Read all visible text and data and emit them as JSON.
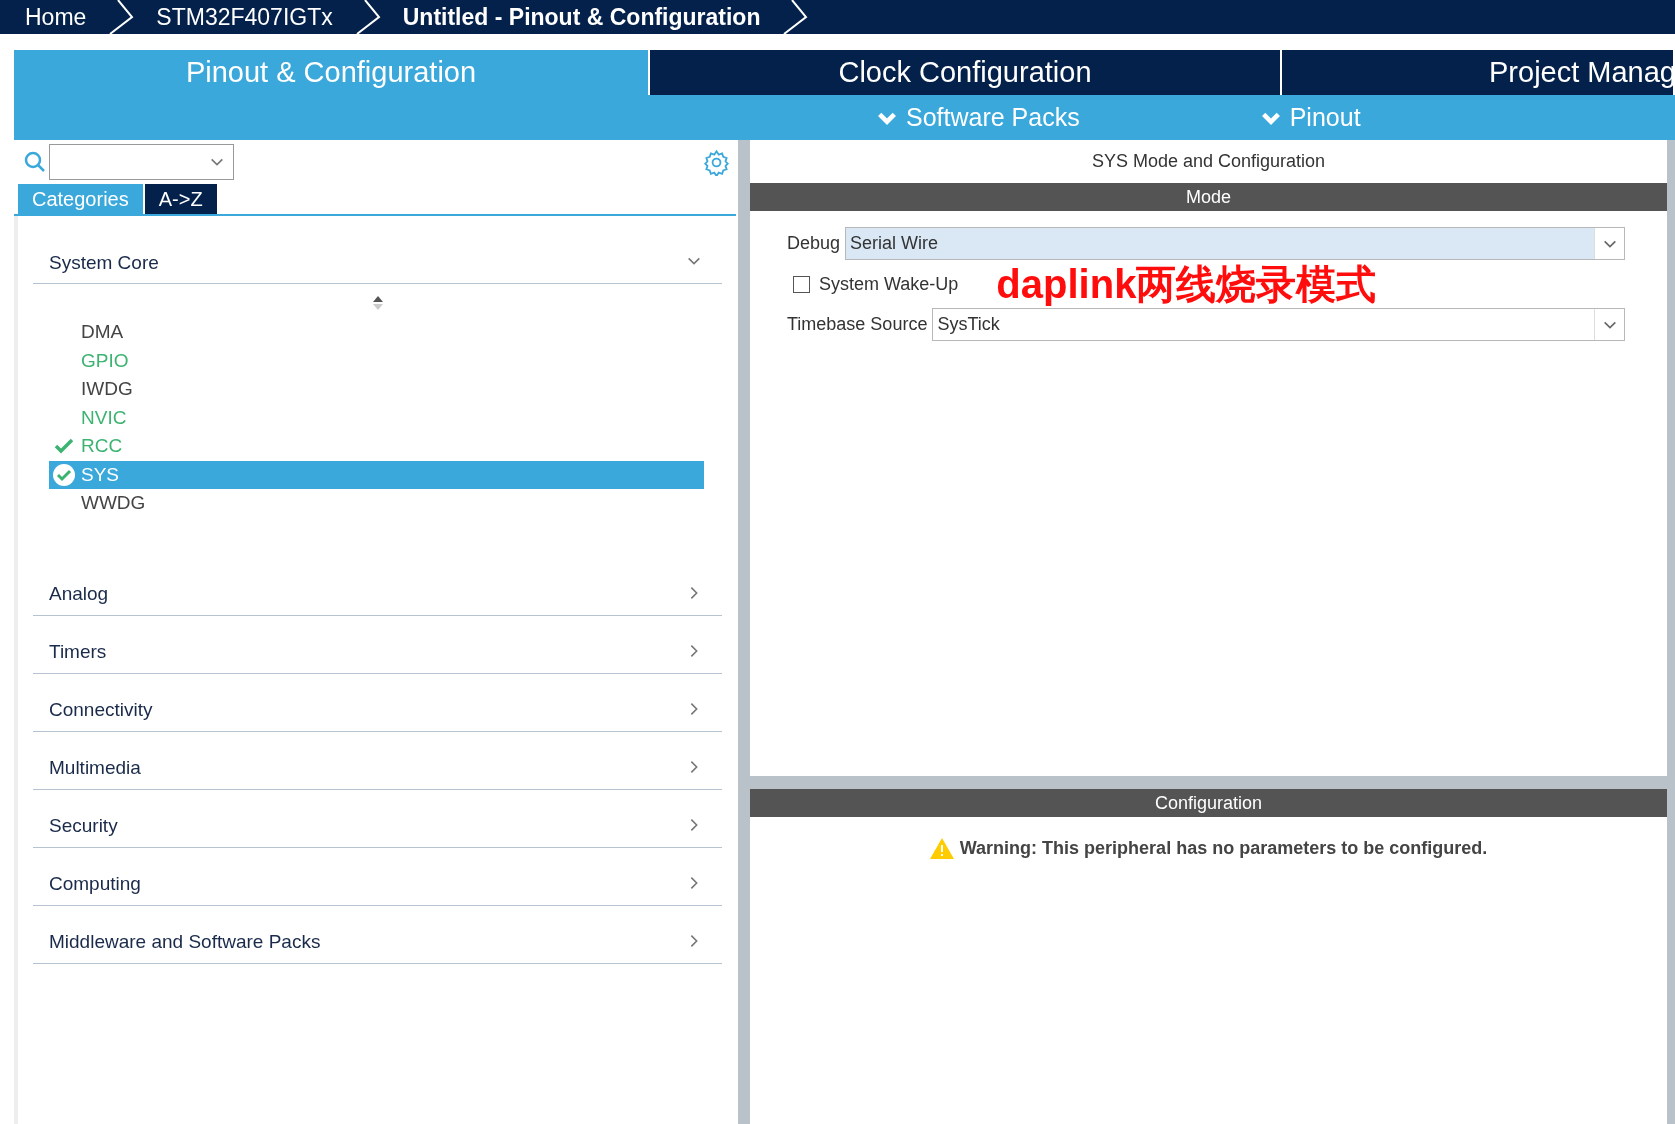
{
  "breadcrumbs": [
    {
      "label": "Home",
      "bold": false
    },
    {
      "label": "STM32F407IGTx",
      "bold": false
    },
    {
      "label": "Untitled - Pinout & Configuration",
      "bold": true
    }
  ],
  "tabs": [
    {
      "label": "Pinout & Configuration",
      "selected": true
    },
    {
      "label": "Clock Configuration",
      "selected": false
    },
    {
      "label": "Project Manag",
      "selected": false
    }
  ],
  "subtabs": [
    "Software Packs",
    "Pinout"
  ],
  "sidebar": {
    "view_tabs": [
      {
        "label": "Categories",
        "selected": true
      },
      {
        "label": "A->Z",
        "selected": false
      }
    ],
    "categories": [
      {
        "label": "System Core",
        "expanded": true,
        "children": [
          {
            "label": "DMA",
            "configured": false,
            "checked": false,
            "selected": false
          },
          {
            "label": "GPIO",
            "configured": true,
            "checked": false,
            "selected": false
          },
          {
            "label": "IWDG",
            "configured": false,
            "checked": false,
            "selected": false
          },
          {
            "label": "NVIC",
            "configured": true,
            "checked": false,
            "selected": false
          },
          {
            "label": "RCC",
            "configured": true,
            "checked": true,
            "selected": false
          },
          {
            "label": "SYS",
            "configured": true,
            "checked": true,
            "selected": true
          },
          {
            "label": "WWDG",
            "configured": false,
            "checked": false,
            "selected": false
          }
        ]
      },
      {
        "label": "Analog",
        "expanded": false
      },
      {
        "label": "Timers",
        "expanded": false
      },
      {
        "label": "Connectivity",
        "expanded": false
      },
      {
        "label": "Multimedia",
        "expanded": false
      },
      {
        "label": "Security",
        "expanded": false
      },
      {
        "label": "Computing",
        "expanded": false
      },
      {
        "label": "Middleware and Software Packs",
        "expanded": false
      }
    ]
  },
  "panel": {
    "title": "SYS Mode and Configuration",
    "mode_header": "Mode",
    "debug": {
      "label": "Debug",
      "value": "Serial Wire"
    },
    "wakeup": {
      "label": "System Wake-Up",
      "checked": false
    },
    "annotation": "daplink两线烧录模式",
    "timebase": {
      "label": "Timebase Source",
      "value": "SysTick"
    },
    "config_header": "Configuration",
    "warning": "Warning: This peripheral has no parameters to be configured."
  }
}
